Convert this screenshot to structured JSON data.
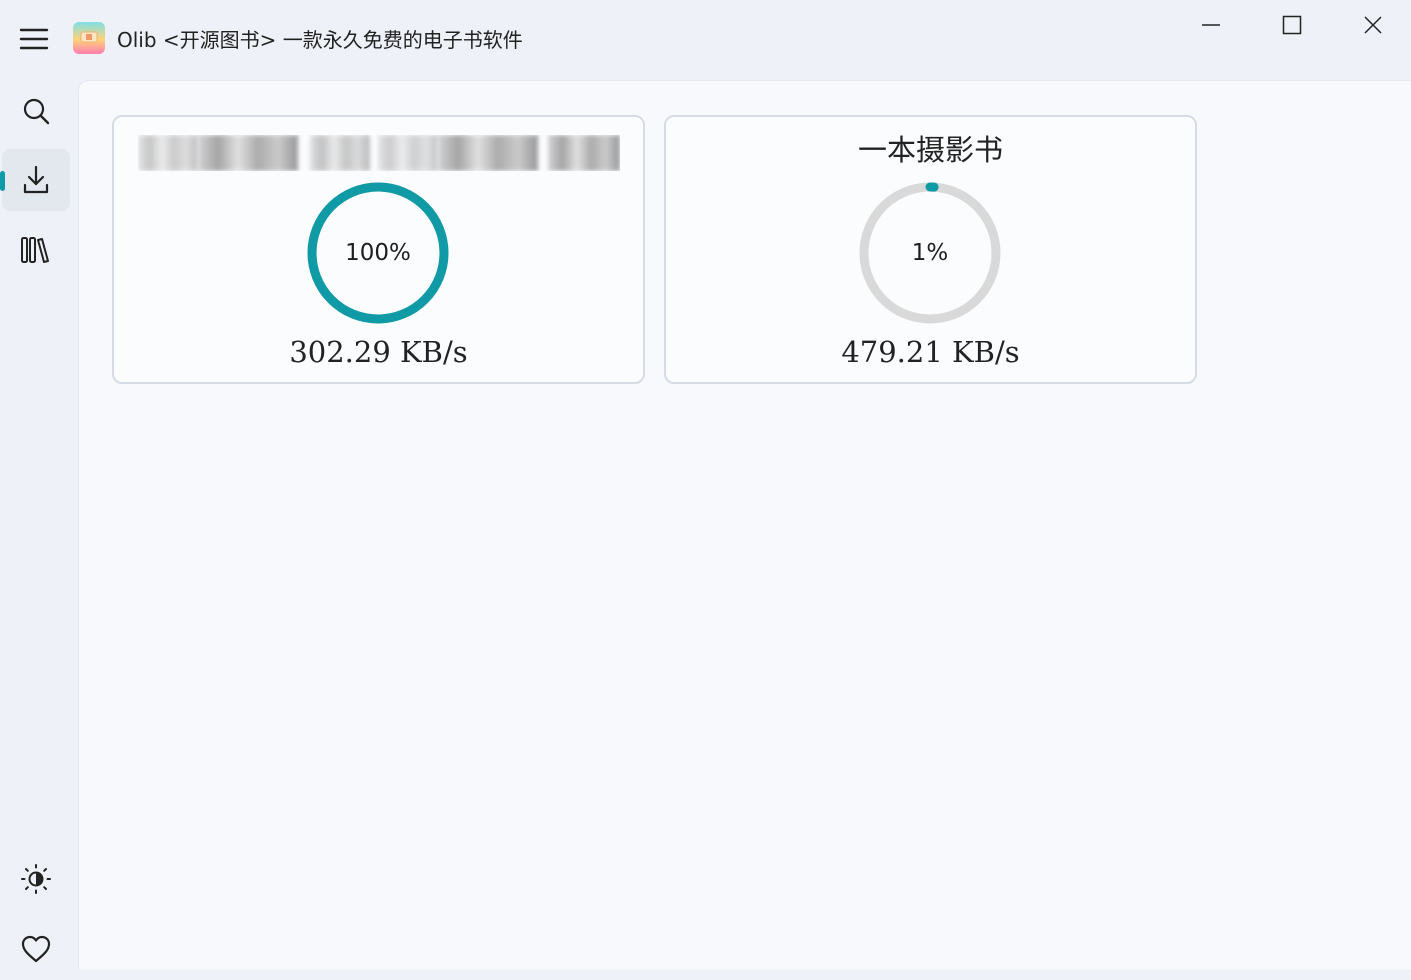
{
  "window": {
    "title": "Olib <开源图书> 一款永久免费的电子书软件",
    "controls": {
      "minimize_icon": "minimize-icon",
      "maximize_icon": "maximize-icon",
      "close_icon": "close-icon"
    }
  },
  "sidebar": {
    "items": [
      {
        "id": "search",
        "icon": "search-icon",
        "active": false
      },
      {
        "id": "downloads",
        "icon": "download-icon",
        "active": true
      },
      {
        "id": "library",
        "icon": "library-icon",
        "active": false
      },
      {
        "id": "theme",
        "icon": "theme-toggle-icon",
        "active": false
      },
      {
        "id": "favorites",
        "icon": "heart-icon",
        "active": false
      }
    ]
  },
  "downloads": [
    {
      "title": "",
      "title_redacted": true,
      "progress_percent": 100,
      "progress_label": "100%",
      "speed": "302.29 KB/s",
      "progress_color": "#0f9aa6"
    },
    {
      "title": "一本摄影书",
      "title_redacted": false,
      "progress_percent": 1,
      "progress_label": "1%",
      "speed": "479.21 KB/s",
      "progress_color": "#0f9aa6"
    }
  ],
  "colors": {
    "accent": "#0f9aa6",
    "ring_track": "#d9d9d9",
    "background": "#eef1f7",
    "content_background": "#f7f9fc"
  }
}
